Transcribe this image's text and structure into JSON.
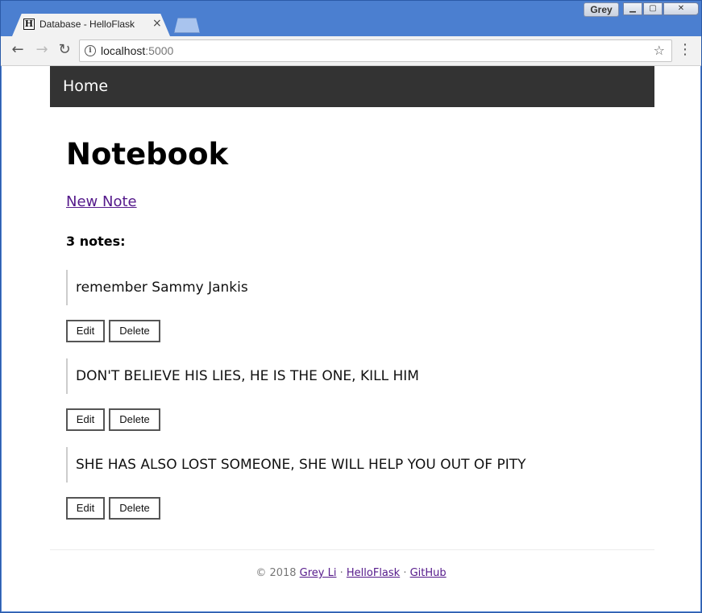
{
  "window": {
    "user": "Grey",
    "controls": {
      "minimize": "▁",
      "maximize": "▢",
      "close": "✕"
    }
  },
  "tab": {
    "favicon": "H",
    "title": "Database - HelloFlask",
    "close": "×"
  },
  "toolbar": {
    "back_icon": "←",
    "forward_icon": "→",
    "reload_icon": "↻",
    "url_host": "localhost",
    "url_port": ":5000",
    "star_icon": "☆",
    "menu_icon": "⋮"
  },
  "navbar": {
    "home": "Home"
  },
  "page": {
    "title": "Notebook",
    "new_note": "New Note",
    "count": "3 notes:"
  },
  "notes": [
    {
      "body": "remember Sammy Jankis",
      "edit": "Edit",
      "delete": "Delete"
    },
    {
      "body": "DON'T BELIEVE HIS LIES, HE IS THE ONE, KILL HIM",
      "edit": "Edit",
      "delete": "Delete"
    },
    {
      "body": "SHE HAS ALSO LOST SOMEONE, SHE WILL HELP YOU OUT OF PITY",
      "edit": "Edit",
      "delete": "Delete"
    }
  ],
  "footer": {
    "copyright": "© 2018 ",
    "author": "Grey Li",
    "sep1": " · ",
    "project": "HelloFlask",
    "sep2": " · ",
    "repo": "GitHub"
  }
}
